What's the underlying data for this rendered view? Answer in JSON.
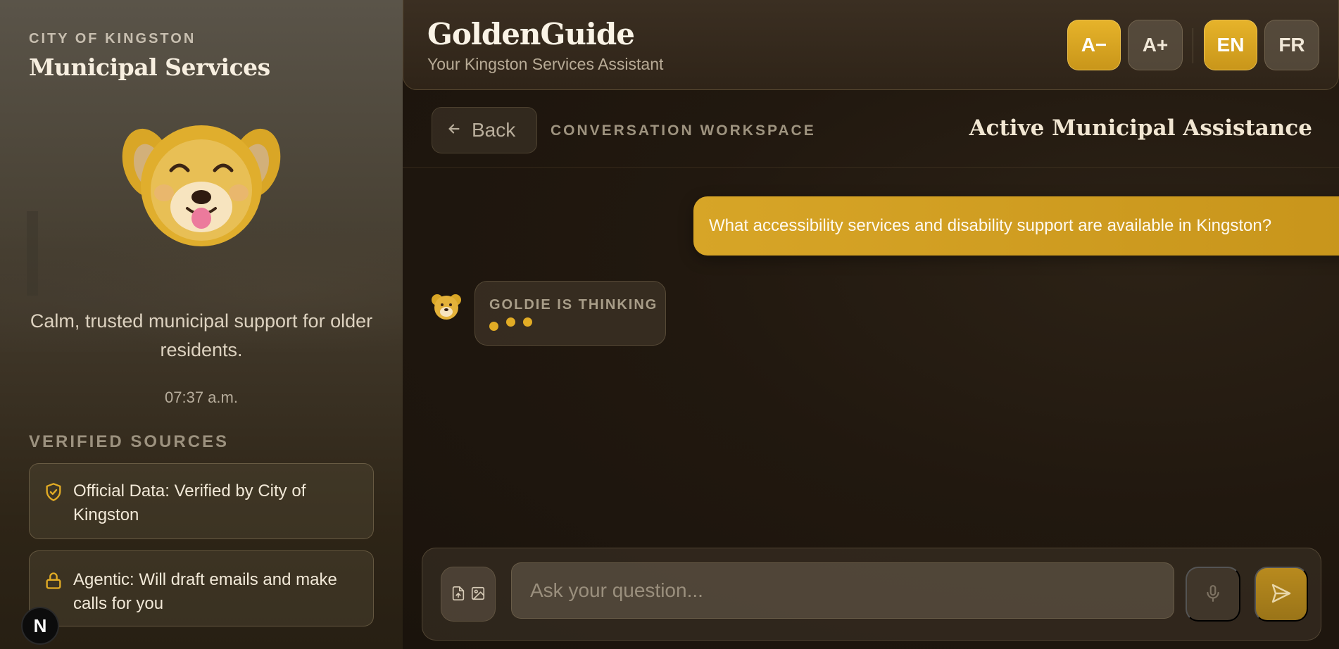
{
  "sidebar": {
    "eyebrow": "CITY OF KINGSTON",
    "title": "Municipal Services",
    "mascot_icon": "bear-mascot-icon",
    "tagline": "Calm, trusted municipal support for older residents.",
    "time": "07:37 a.m.",
    "sources_heading": "VERIFIED SOURCES",
    "sources": [
      {
        "icon": "shield-check-icon",
        "text": "Official Data: Verified by City of Kingston"
      },
      {
        "icon": "lock-icon",
        "text": "Agentic: Will draft emails and make calls for you"
      }
    ],
    "badge_letter": "N"
  },
  "header": {
    "brand": "GoldenGuide",
    "subtitle": "Your Kingston Services Assistant",
    "font_decrease": "A−",
    "font_increase": "A+",
    "lang_en": "EN",
    "lang_fr": "FR",
    "active_language": "EN"
  },
  "subbar": {
    "back_label": "Back",
    "workspace_label": "CONVERSATION WORKSPACE",
    "active_title": "Active Municipal Assistance"
  },
  "chat": {
    "user_message": "What accessibility services and disability support are available in Kingston?",
    "thinking_label": "GOLDIE IS THINKING"
  },
  "composer": {
    "placeholder": "Ask your question...",
    "attach_icons": [
      "file-upload-icon",
      "image-icon"
    ],
    "mic_icon": "microphone-icon",
    "send_icon": "send-icon"
  },
  "colors": {
    "accent_gold": "#d7a527",
    "background": "#1c140d",
    "text_light": "#efe6d6"
  }
}
